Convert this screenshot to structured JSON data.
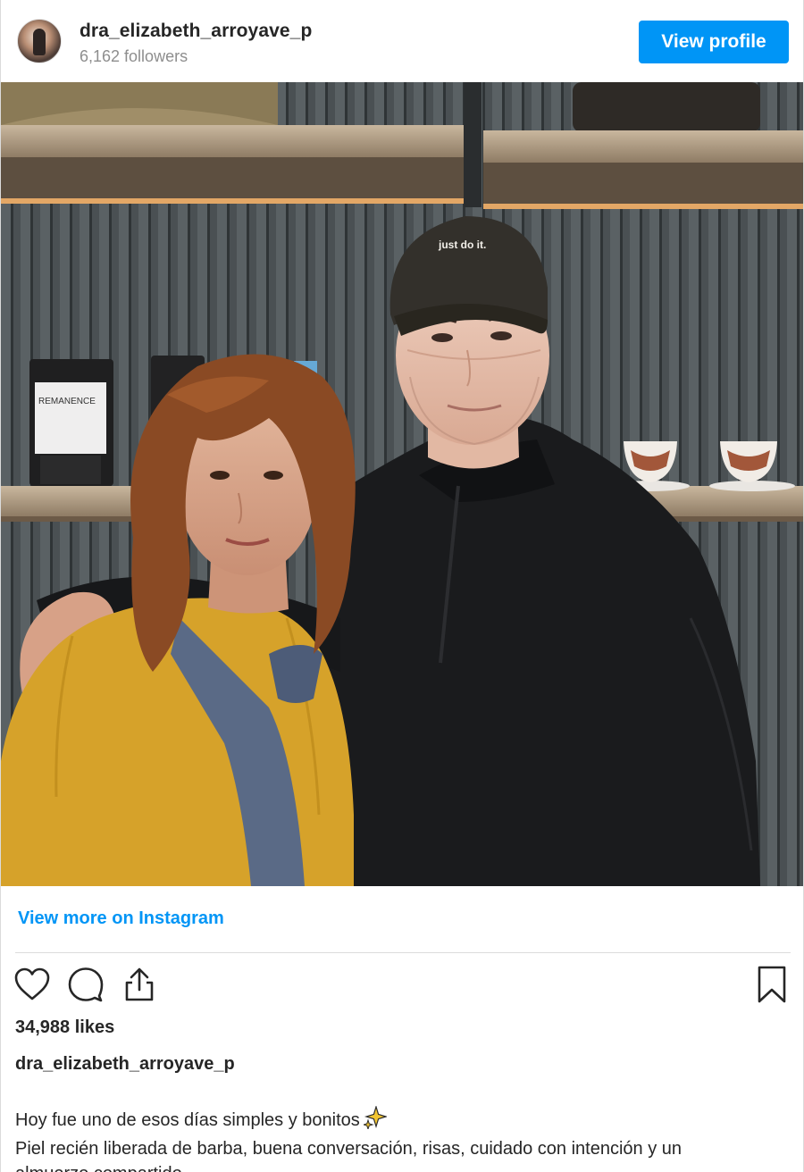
{
  "header": {
    "username": "dra_elizabeth_arroyave_p",
    "followers": "6,162 followers",
    "view_profile_label": "View profile"
  },
  "photo": {
    "cap_text": "just do it.",
    "bag_label": "REMANENCE"
  },
  "footer": {
    "view_more_label": "View more on Instagram",
    "likes": "34,988 likes",
    "caption_username": "dra_elizabeth_arroyave_p",
    "caption_line_1": "Hoy fue uno de esos días simples y bonitos",
    "caption_line_2": "Piel recién liberada de barba, buena conversación, risas, cuidado con intención y un",
    "caption_line_3": "almuerzo compartido."
  },
  "icons": {
    "like": "heart-icon",
    "comment": "comment-bubble-icon",
    "share": "share-upload-icon",
    "save": "bookmark-icon",
    "caption_emoji": "sparkles-icon"
  },
  "colors": {
    "accent": "#0095f6",
    "text": "#262626",
    "muted": "#8e8e8e"
  }
}
